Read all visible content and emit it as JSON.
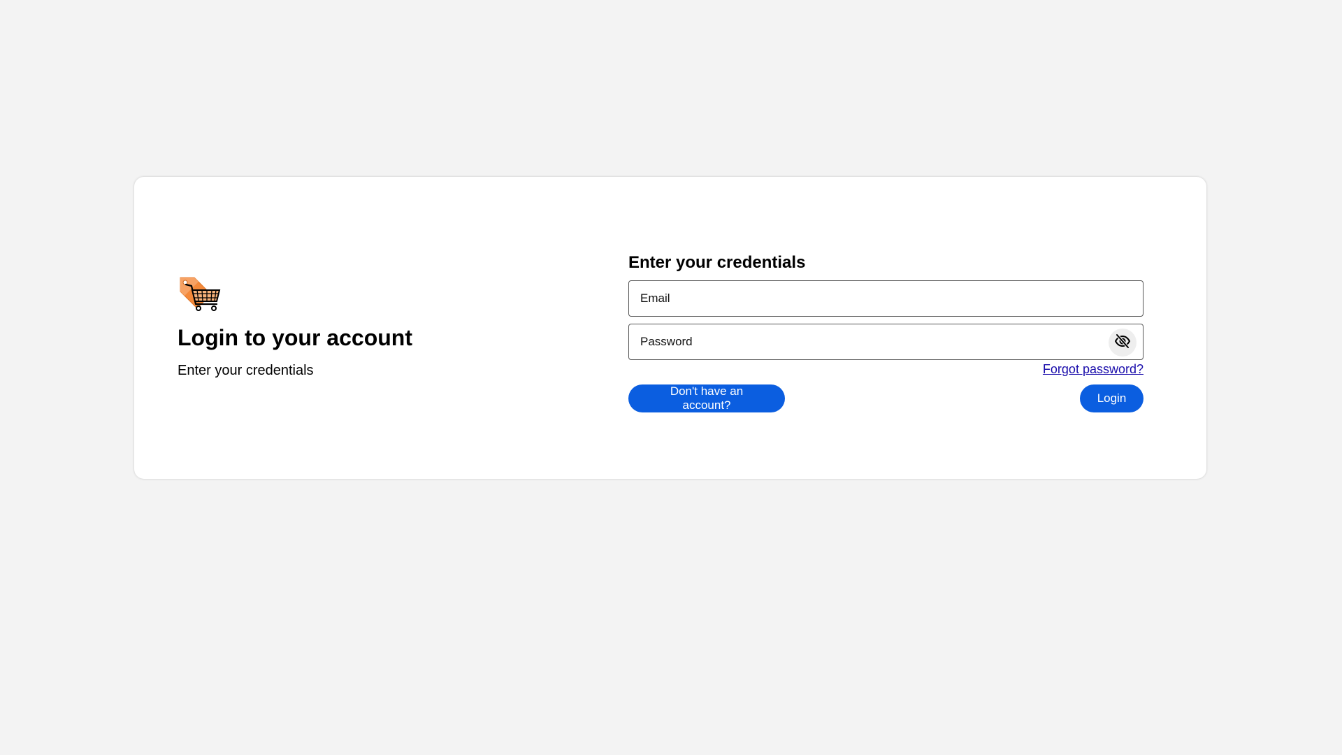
{
  "branding": {
    "logo_icon": "shopping-cart-tag-icon",
    "title": "Login to your account",
    "subtitle": "Enter your credentials"
  },
  "form": {
    "heading": "Enter your credentials",
    "email_placeholder": "Email",
    "password_placeholder": "Password",
    "toggle_password_icon": "eye-off-icon",
    "forgot_password_label": "Forgot password?",
    "signup_label": "Don't have an account?",
    "login_label": "Login"
  },
  "colors": {
    "background": "#f3f3f3",
    "card": "#ffffff",
    "primary_button": "#0b5ee0",
    "link": "#1a0dab",
    "logo_tag": "#f4893a"
  }
}
